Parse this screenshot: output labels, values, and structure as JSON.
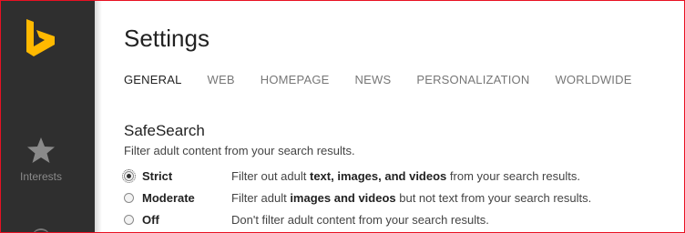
{
  "sidebar": {
    "logo_icon": "bing-logo-icon",
    "brand_color": "#ffb900",
    "background": "#2f2f2f",
    "items": [
      {
        "label": "Interests",
        "icon": "star-icon"
      }
    ]
  },
  "page": {
    "title": "Settings"
  },
  "tabs": [
    {
      "label": "GENERAL",
      "active": true
    },
    {
      "label": "WEB",
      "active": false
    },
    {
      "label": "HOMEPAGE",
      "active": false
    },
    {
      "label": "NEWS",
      "active": false
    },
    {
      "label": "PERSONALIZATION",
      "active": false
    },
    {
      "label": "WORLDWIDE",
      "active": false
    }
  ],
  "safesearch": {
    "title": "SafeSearch",
    "description": "Filter adult content from your search results.",
    "selected": "Strict",
    "options": [
      {
        "name": "Strict",
        "desc_pre": "Filter out adult ",
        "desc_bold": "text, images, and videos",
        "desc_post": " from your search results."
      },
      {
        "name": "Moderate",
        "desc_pre": "Filter adult ",
        "desc_bold": "images and videos",
        "desc_post": " but not text from your search results."
      },
      {
        "name": "Off",
        "desc_pre": "Don't filter adult content from your search results.",
        "desc_bold": "",
        "desc_post": ""
      }
    ]
  }
}
